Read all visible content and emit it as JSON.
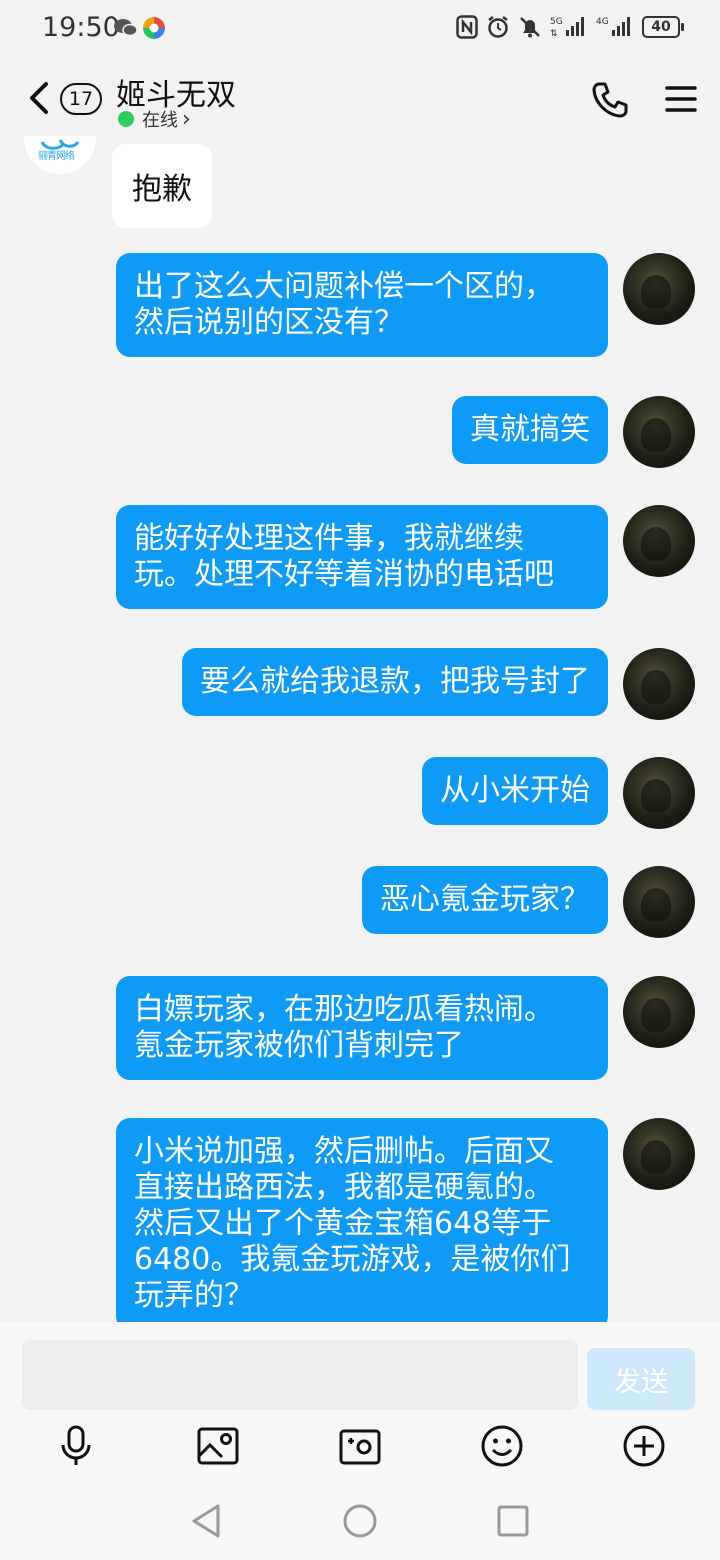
{
  "status_bar": {
    "time": "19:50",
    "battery": "40"
  },
  "header": {
    "unread_count": "17",
    "title": "姬斗无双",
    "status": "在线",
    "status_chevron": "›"
  },
  "incoming": {
    "avatar_logo": "骊青网络",
    "text": "抱歉"
  },
  "outgoing": [
    {
      "lines": [
        "出了这么大问题补偿一个区的，",
        "然后说别的区没有？"
      ]
    },
    {
      "lines": [
        "真就搞笑"
      ]
    },
    {
      "lines": [
        "能好好处理这件事，我就继续",
        "玩。处理不好等着消协的电话吧"
      ]
    },
    {
      "lines": [
        "要么就给我退款，把我号封了"
      ]
    },
    {
      "lines": [
        "从小米开始"
      ]
    },
    {
      "lines": [
        "恶心氪金玩家？"
      ]
    },
    {
      "lines": [
        "白嫖玩家，在那边吃瓜看热闹。",
        "氪金玩家被你们背刺完了"
      ]
    },
    {
      "lines": [
        "小米说加强，然后删帖。后面又",
        "直接出路西法，我都是硬氪的。",
        "然后又出了个黄金宝箱648等于",
        "6480。我氪金玩游戏，是被你们",
        "玩弄的？"
      ]
    }
  ],
  "input": {
    "placeholder": "",
    "send_label": "发送"
  },
  "colors": {
    "bubble": "#0f9bf5",
    "send_disabled": "#cde8fb",
    "online": "#2fcd5b"
  },
  "icons": {
    "toolbar": [
      "microphone-icon",
      "image-icon",
      "camera-icon",
      "emoji-icon",
      "plus-icon"
    ],
    "nav": [
      "back-triangle-icon",
      "home-circle-icon",
      "recents-square-icon"
    ]
  }
}
